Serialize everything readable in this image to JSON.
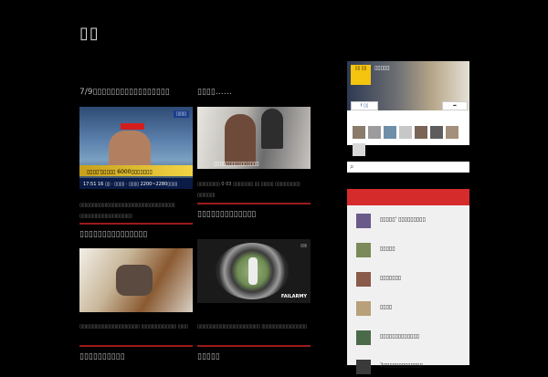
{
  "site": {
    "title": "▯▯"
  },
  "posts": [
    {
      "title": "7/9▯▯▯▯▯▯▯▯▯▯▯▯▯▯▯▯▯",
      "excerpt": "▯▯▯▯▯▯▯▯▯▯▯▯▯▯▯▯▯▯▯▯▯▯▯▯▯▯▯▯▯▯▯▯▯▯▯▯▯▯ ▯▯▯▯▯▯▯▯▯▯▯▯▯▯▯▯▯▯▯▯▯",
      "thumb": {
        "news_text": "▯▯▯▯'▯▯▯▯▯ 6000▯▯▯▯▯▯▯",
        "ticker_text": "17:51 16 ▯▯ · ▯▯▯▯ · ▯▯▯▯ 2200~2280▯▯▯▯",
        "channel": "▯▯▯▯"
      }
    },
    {
      "title": "▯▯▯▯……",
      "excerpt": "▯▯▯▯▯▯▯▯▯ 0 03 ▯▯▯▯▯▯▯▯ ▯▯ ▯▯▯▯▯ ▯▯▯▯▯▯▯▯▯▯ ▯▯▯▯▯▯▯",
      "thumb": {
        "caption": "▯▯▯▯▯▯▯▯▯▯▯▯▯▯▯"
      }
    },
    {
      "title": "▯▯▯▯▯▯▯▯▯▯▯▯▯▯▯",
      "excerpt": "▯▯▯▯▯▯▯▯▯▯▯▯▯▯▯▯▯▯▯▯▯▯▯▯ ▯▯▯▯▯▯▯▯▯▯▯▯▯▯ ▯▯▯▯",
      "thumb": {}
    },
    {
      "title": "▯▯▯▯▯▯▯▯▯▯▯▯▯",
      "excerpt": "▯▯▯▯▯▯▯▯▯▯▯▯▯▯▯▯▯▯▯▯▯▯▯▯▯ ▯▯▯▯▯▯▯▯▯▯▯▯▯▯▯▯▯▯",
      "thumb": {
        "brand": "FAILARMY",
        "rec": "▯▯▯"
      }
    }
  ],
  "more_posts": [
    {
      "title": "▯▯▯▯▯▯▯▯▯▯"
    },
    {
      "title": "▯▯▯▯▯"
    }
  ],
  "sidebar": {
    "facebook": {
      "page_name": "▯▯▯▯▯",
      "logo_text": "▯▯ ▯▯",
      "like_label": "f ▯▯",
      "share_label": "➦",
      "face_colors": [
        "#8a7b6a",
        "#9c9c9c",
        "#6f8fa8",
        "#c7c7c7",
        "#7a6458",
        "#5d5d5d",
        "#a38f7b",
        "#d8d8d8"
      ]
    },
    "search": {
      "placeholder": ""
    },
    "popular_posts": [
      {
        "title": "▯▯▯▯▯' ▯▯▯▯▯▯▯▯▯",
        "thumb_color": "#6a5a8a"
      },
      {
        "title": "▯▯▯▯▯",
        "thumb_color": "#7a8a5a"
      },
      {
        "title": "▯▯▯▯▯▯▯",
        "thumb_color": "#8a5a4a"
      },
      {
        "title": "▯▯▯▯",
        "thumb_color": "#b8a07a"
      },
      {
        "title": "▯▯▯▯▯▯▯▯▯▯▯▯▯",
        "thumb_color": "#4a6a4a"
      },
      {
        "title": "2▯▯▯▯▯▯▯▯▯▯▯▯▯",
        "thumb_color": "#3a3a3a"
      }
    ]
  },
  "colors": {
    "accent": "#d62b2b",
    "background": "#000000",
    "rule": "#9b1b1b"
  }
}
